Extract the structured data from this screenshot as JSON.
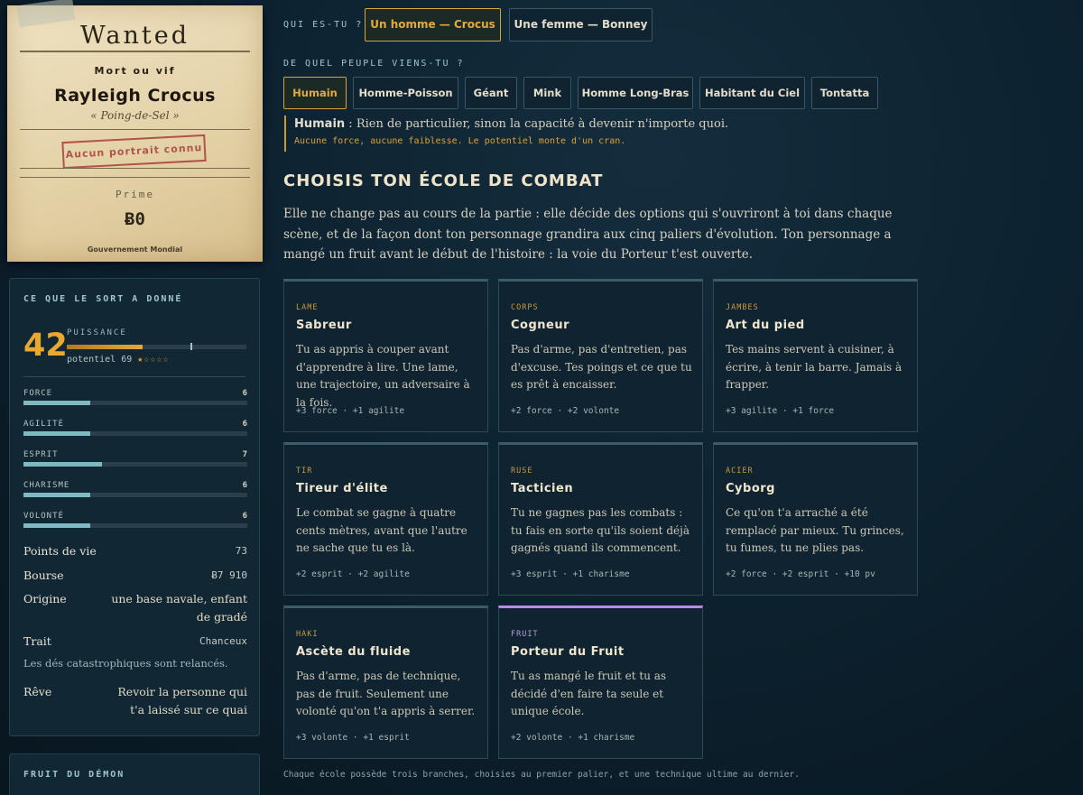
{
  "poster": {
    "title": "Wanted",
    "subtitle": "Mort ou vif",
    "name": "Rayleigh Crocus",
    "epithet": "« Poing-de-Sel »",
    "portrait_stamp": "Aucun portrait connu",
    "prime_label": "Prime",
    "prime_value": "Ƀ0",
    "footer": "Gouvernement Mondial"
  },
  "sheet": {
    "title": "CE QUE LE SORT A DONNÉ",
    "power": {
      "value": "42",
      "label": "PUISSANCE",
      "fill_fraction": 0.42,
      "potential_text": "potentiel 69",
      "potential_fraction": 0.69,
      "stars": "★☆☆☆☆"
    },
    "stats": [
      {
        "name": "FORCE",
        "value": "6",
        "fraction": 0.3
      },
      {
        "name": "AGILITÉ",
        "value": "6",
        "fraction": 0.3
      },
      {
        "name": "ESPRIT",
        "value": "7",
        "fraction": 0.35
      },
      {
        "name": "CHARISME",
        "value": "6",
        "fraction": 0.3
      },
      {
        "name": "VOLONTÉ",
        "value": "6",
        "fraction": 0.3
      }
    ],
    "info": {
      "hp_label": "Points de vie",
      "hp_value": "73",
      "purse_label": "Bourse",
      "purse_value": "Ƀ7 910",
      "origin_label": "Origine",
      "origin_value": "une base navale, enfant de gradé",
      "trait_label": "Trait",
      "trait_value": "Chanceux",
      "trait_note": "Les dés catastrophiques sont relancés.",
      "dream_label": "Rêve",
      "dream_value": "Revoir la personne qui t'a laissé sur ce quai"
    }
  },
  "fruit_panel": {
    "title": "FRUIT DU DÉMON"
  },
  "gender": {
    "question": "QUI ES-TU ?",
    "options": [
      "Un homme — Crocus",
      "Une femme — Bonney"
    ],
    "selected": 0
  },
  "people": {
    "question": "DE QUEL PEUPLE VIENS-TU ?",
    "options": [
      "Humain",
      "Homme-Poisson",
      "Géant",
      "Mink",
      "Homme Long-Bras",
      "Habitant du Ciel",
      "Tontatta"
    ],
    "selected": 0,
    "desc_name": "Humain",
    "desc_text": " : Rien de particulier, sinon la capacité à devenir n'importe quoi.",
    "desc_sub": "Aucune force, aucune faiblesse. Le potentiel monte d'un cran."
  },
  "school": {
    "heading": "CHOISIS TON ÉCOLE DE COMBAT",
    "intro": "Elle ne change pas au cours de la partie : elle décide des options qui s'ouvriront à toi dans chaque scène, et de la façon dont ton personnage grandira aux cinq paliers d'évolution. Ton personnage a mangé un fruit avant le début de l'histoire : la voie du Porteur t'est ouverte.",
    "cards": [
      {
        "tag": "LAME",
        "title": "Sabreur",
        "text": "Tu as appris à couper avant d'apprendre à lire. Une lame, une trajectoire, un adversaire à la fois.",
        "bonus": "+3 force · +1 agilite"
      },
      {
        "tag": "CORPS",
        "title": "Cogneur",
        "text": "Pas d'arme, pas d'entretien, pas d'excuse. Tes poings et ce que tu es prêt à encaisser.",
        "bonus": "+2 force · +2 volonte"
      },
      {
        "tag": "JAMBES",
        "title": "Art du pied",
        "text": "Tes mains servent à cuisiner, à écrire, à tenir la barre. Jamais à frapper.",
        "bonus": "+3 agilite · +1 force"
      },
      {
        "tag": "TIR",
        "title": "Tireur d'élite",
        "text": "Le combat se gagne à quatre cents mètres, avant que l'autre ne sache que tu es là.",
        "bonus": "+2 esprit · +2 agilite"
      },
      {
        "tag": "RUSE",
        "title": "Tacticien",
        "text": "Tu ne gagnes pas les combats : tu fais en sorte qu'ils soient déjà gagnés quand ils commencent.",
        "bonus": "+3 esprit · +1 charisme"
      },
      {
        "tag": "ACIER",
        "title": "Cyborg",
        "text": "Ce qu'on t'a arraché a été remplacé par mieux. Tu grinces, tu fumes, tu ne plies pas.",
        "bonus": "+2 force · +2 esprit · +10 pv"
      },
      {
        "tag": "HAKI",
        "title": "Ascète du fluide",
        "text": "Pas d'arme, pas de technique, pas de fruit. Seulement une volonté qu'on t'a appris à serrer.",
        "bonus": "+3 volonte · +1 esprit"
      },
      {
        "tag": "FRUIT",
        "title": "Porteur du Fruit",
        "text": "Tu as mangé le fruit et tu as décidé d'en faire ta seule et unique école.",
        "bonus": "+2 volonte · +1 charisme"
      }
    ],
    "footnote": "Chaque école possède trois branches, choisies au premier palier, et une technique ultime au dernier."
  },
  "colors": {
    "accent": "#e5ab3a",
    "fruit": "#b78be3",
    "stat_bar": "#7fb9c2"
  }
}
